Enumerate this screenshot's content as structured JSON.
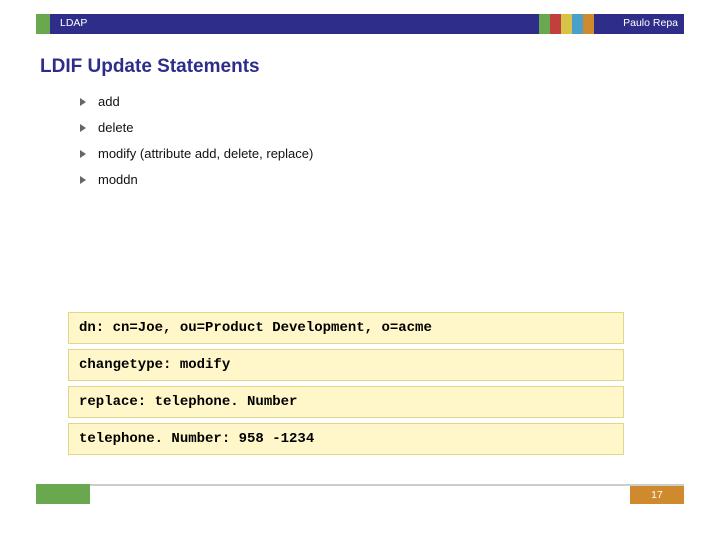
{
  "header": {
    "label": "LDAP",
    "author": "Paulo Repa",
    "clr_accent": "#6aa84f",
    "clr_bar": "#2e2e8a",
    "swatches": [
      "#6aa84f",
      "#c04040",
      "#d8c24a",
      "#4aa0c8",
      "#d08a2e"
    ]
  },
  "title": "LDIF Update Statements",
  "bullets": {
    "items": [
      "add",
      "delete",
      "modify (attribute add, delete, replace)",
      "moddn"
    ]
  },
  "code": {
    "l0": "dn: cn=Joe, ou=Product Development, o=acme",
    "l1": "changetype: modify",
    "l2": "replace: telephone. Number",
    "l3": "telephone. Number: 958 -1234"
  },
  "footer": {
    "page": "17"
  }
}
